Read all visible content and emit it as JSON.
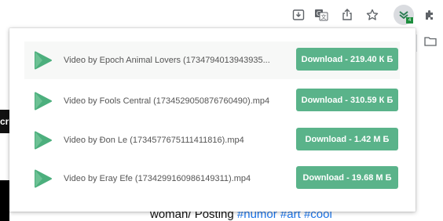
{
  "toolbar": {
    "icons": [
      "install-app-icon",
      "translate-icon",
      "share-icon",
      "bookmark-star-icon",
      "video-downloader-extension-icon",
      "extensions-puzzle-icon"
    ],
    "extension_badge": "4"
  },
  "background_page": {
    "dark_label_text": "cr",
    "caption_text": "woman/ Posting ",
    "hashtags": [
      "#humor",
      "#art",
      "#cool"
    ]
  },
  "popup": {
    "items": [
      {
        "title": "Video by Epoch Animal Lovers (1734794013943935...",
        "download_label": "Download - 219.40 К Б"
      },
      {
        "title": "Video by Fools Central (1734529050876760490).mp4",
        "download_label": "Download - 310.59 К Б"
      },
      {
        "title": "Video by Đon Le (1734577675111411816).mp4",
        "download_label": "Download - 1.42 М Б"
      },
      {
        "title": "Video by Eray Efe (1734299160986149311).mp4",
        "download_label": "Download - 19.68 М Б"
      }
    ]
  },
  "colors": {
    "accent_green": "#5ab38a",
    "play_icon_green": "#4caf7d"
  }
}
